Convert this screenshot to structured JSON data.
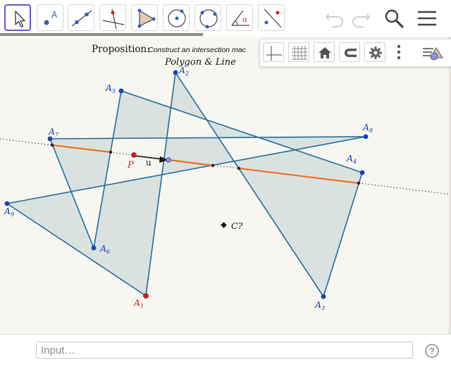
{
  "toolbar": {
    "tools": [
      {
        "name": "move-tool",
        "icon": "arrow-cursor-icon"
      },
      {
        "name": "point-tool",
        "icon": "point-icon",
        "label": "A"
      },
      {
        "name": "line-tool",
        "icon": "line-through-two-points-icon"
      },
      {
        "name": "perpendicular-line-tool",
        "icon": "perpendicular-line-icon"
      },
      {
        "name": "polygon-tool",
        "icon": "polygon-icon"
      },
      {
        "name": "circle-center-point-tool",
        "icon": "circle-with-center-icon"
      },
      {
        "name": "circle-three-points-tool",
        "icon": "circle-through-three-points-icon"
      },
      {
        "name": "angle-tool",
        "icon": "angle-icon",
        "label": "α"
      },
      {
        "name": "reflect-about-line-tool",
        "icon": "reflect-about-line-icon"
      }
    ],
    "undo_icon": "undo-icon",
    "redo_icon": "redo-icon",
    "search_icon": "search-icon",
    "menu_icon": "hamburger-menu-icon"
  },
  "stylebar": {
    "buttons": [
      "axes-icon",
      "grid-icon",
      "home-icon",
      "point-capturing-magnet-icon",
      "settings-gear-icon",
      "more-vertical-icon"
    ],
    "toggle_icon": "style-bar-toggle-icon"
  },
  "canvas": {
    "proposition_label": "Proposition:",
    "proposition_text": "Construct an intersection mac",
    "subtitle": "Polygon & Line",
    "vertex_labels": {
      "A1": {
        "base": "A",
        "sub": "1"
      },
      "A2": {
        "base": "A",
        "sub": "2"
      },
      "A3": {
        "base": "A",
        "sub": "3"
      },
      "A4": {
        "base": "A",
        "sub": "4"
      },
      "A5": {
        "base": "A",
        "sub": "5"
      },
      "A6": {
        "base": "A",
        "sub": "6"
      },
      "A7": {
        "base": "A",
        "sub": "7"
      },
      "A8": {
        "base": "A",
        "sub": "8"
      },
      "A9": {
        "base": "A",
        "sub": "9"
      }
    },
    "point_P": "P",
    "vector_u": "u",
    "point_C": "C?",
    "colors": {
      "polygon_fill": "#c6d6d6",
      "polygon_edge": "#1f6d9a",
      "intersection_segment": "#ef7020",
      "vertex_blue": "#1a3fb5",
      "point_red": "#d62020",
      "label_blue": "#1a3fb5",
      "label_red": "#d62020",
      "background": "#f8f6f0"
    }
  },
  "input_bar": {
    "placeholder": "Input…",
    "value": "",
    "help_icon": "help-question-icon"
  }
}
